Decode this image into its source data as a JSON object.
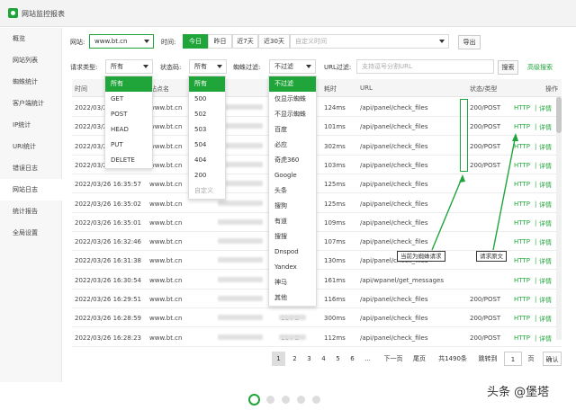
{
  "window": {
    "title": "网站监控报表"
  },
  "sidebar": {
    "items": [
      {
        "label": "概览"
      },
      {
        "label": "网站列表"
      },
      {
        "label": "蜘蛛统计"
      },
      {
        "label": "客户端统计"
      },
      {
        "label": "IP统计"
      },
      {
        "label": "URI统计"
      },
      {
        "label": "错误日志"
      },
      {
        "label": "网站日志",
        "active": true
      },
      {
        "label": "统计报告"
      },
      {
        "label": "全局设置"
      }
    ]
  },
  "filters": {
    "site_label": "网站:",
    "site_value": "www.bt.cn",
    "time_label": "时间:",
    "time_tabs": [
      "今日",
      "昨日",
      "近7天",
      "近30天"
    ],
    "custom_time_placeholder": "自定义时间",
    "export_label": "导出",
    "request_type_label": "请求类型:",
    "request_type_value": "所有",
    "status_code_label": "状态码:",
    "status_code_value": "所有",
    "spider_filter_label": "蜘蛛过滤:",
    "spider_filter_value": "不过滤",
    "url_filter_label": "URL过滤:",
    "url_filter_placeholder": "支持逗号分割URL",
    "search_label": "搜索",
    "advanced_search_label": "高级搜索"
  },
  "table": {
    "headers": {
      "time": "时间",
      "site": "站点名",
      "ip": "IP",
      "size": "大小",
      "duration": "耗时",
      "url": "URL",
      "status": "状态/类型",
      "ops": "操作"
    },
    "rows": [
      {
        "time": "2022/03/2",
        "site": "www.bt.cn",
        "size": "",
        "duration": "124ms",
        "url": "/api/panel/check_files",
        "status": "200/POST"
      },
      {
        "time": "2022/03/2",
        "site": "www.bt.cn",
        "size": "",
        "duration": "101ms",
        "url": "/api/panel/check_files",
        "status": "200/POST"
      },
      {
        "time": "2022/03/2",
        "site": "www.bt.cn",
        "size": "",
        "duration": "302ms",
        "url": "/api/panel/check_files",
        "status": "200/POST"
      },
      {
        "time": "2022/03/2",
        "site": "www.bt.cn",
        "size": "",
        "duration": "103ms",
        "url": "/api/panel/check_files",
        "status": "200/POST"
      },
      {
        "time": "2022/03/26 16:35:57",
        "site": "www.bt.cn",
        "size": "",
        "duration": "125ms",
        "url": "/api/panel/check_files",
        "status": ""
      },
      {
        "time": "2022/03/26 16:35:02",
        "site": "www.bt.cn",
        "size": "",
        "duration": "125ms",
        "url": "/api/panel/check_files",
        "status": ""
      },
      {
        "time": "2022/03/26 16:35:01",
        "site": "www.bt.cn",
        "size": "",
        "duration": "109ms",
        "url": "/api/panel/check_files",
        "status": ""
      },
      {
        "time": "2022/03/26 16:32:46",
        "site": "www.bt.cn",
        "size": "",
        "duration": "107ms",
        "url": "/api/panel/check_files",
        "status": ""
      },
      {
        "time": "2022/03/26 16:31:38",
        "site": "www.bt.cn",
        "size": "",
        "duration": "130ms",
        "url": "/api/panel/check_files",
        "status": ""
      },
      {
        "time": "2022/03/26 16:30:54",
        "site": "www.bt.cn",
        "size": "",
        "duration": "161ms",
        "url": "/api/wpanel/get_messages",
        "status": ""
      },
      {
        "time": "2022/03/26 16:29:51",
        "site": "www.bt.cn",
        "size": "",
        "duration": "116ms",
        "url": "/api/panel/check_files",
        "status": "200/POST"
      },
      {
        "time": "2022/03/26 16:28:59",
        "site": "www.bt.cn",
        "size": "114 B",
        "duration": "300ms",
        "url": "/api/panel/check_files",
        "status": "200/POST"
      },
      {
        "time": "2022/03/26 16:28:23",
        "site": "www.bt.cn",
        "size": "114 B",
        "duration": "112ms",
        "url": "/api/panel/check_files",
        "status": "200/POST"
      }
    ],
    "op_http": "HTTP",
    "op_sep": "|",
    "op_detail": "详情"
  },
  "dropdowns": {
    "request_type": {
      "options": [
        "所有",
        "GET",
        "POST",
        "HEAD",
        "PUT",
        "DELETE"
      ],
      "selected": "所有"
    },
    "status_code": {
      "options": [
        "所有",
        "500",
        "502",
        "503",
        "504",
        "404",
        "200",
        "自定义"
      ],
      "selected": "所有"
    },
    "spider_filter": {
      "options": [
        "不过滤",
        "仅显示蜘蛛",
        "不显示蜘蛛",
        "百度",
        "必应",
        "奇虎360",
        "Google",
        "头条",
        "搜狗",
        "有道",
        "搜搜",
        "Dnspod",
        "Yandex",
        "神马",
        "其他"
      ],
      "selected": "不过滤"
    }
  },
  "annotations": {
    "spider_request": "当前为蜘蛛请求",
    "request_source": "请求原文"
  },
  "pagination": {
    "pages": [
      "1",
      "2",
      "3",
      "4",
      "5",
      "6",
      "..."
    ],
    "next": "下一页",
    "last": "尾页",
    "total": "共1490条",
    "goto_label": "跳转到",
    "goto_value": "1",
    "page_unit": "页",
    "confirm": "确认"
  },
  "watermark": {
    "text": "头条 @堡塔"
  },
  "colors": {
    "accent": "#20a53a"
  }
}
